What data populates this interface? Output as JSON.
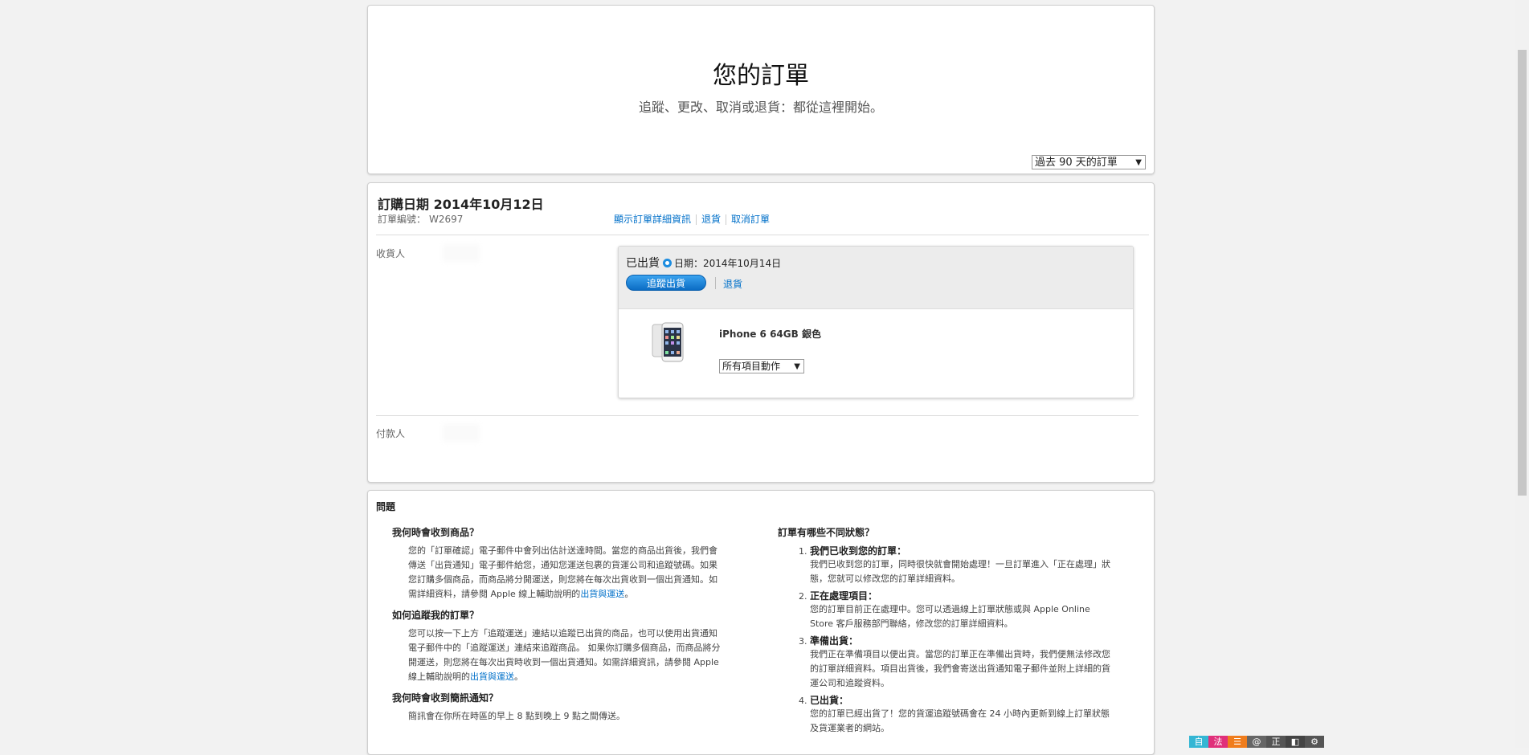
{
  "hero": {
    "title": "您的訂單",
    "subtitle": "追蹤、更改、取消或退貨：都從這裡開始。",
    "range_select": "過去 90 天的訂單"
  },
  "order": {
    "date_label": "訂購日期 2014年10月12日",
    "number_label": "訂單編號：",
    "number_value": "W2697",
    "links": [
      "顯示訂單詳細資訊",
      "退貨",
      "取消訂單"
    ],
    "recipient_label": "收貨人",
    "payer_label": "付款人",
    "shipment": {
      "status": "已出貨",
      "date_label": "日期：2014年10月14日",
      "track_button": "追蹤出貨",
      "return_link": "退貨",
      "product_name": "iPhone 6 64GB 銀色",
      "item_action": "所有項目動作"
    }
  },
  "faq": {
    "title": "問題",
    "left": [
      {
        "q": "我何時會收到商品？",
        "a": "您的「訂單確認」電子郵件中會列出估計送達時間。當您的商品出貨後，我們會傳送「出貨通知」電子郵件給您，通知您運送包裹的貨運公司和追蹤號碼。如果您訂購多個商品，而商品將分開運送，則您將在每次出貨收到一個出貨通知。如需詳細資料，請參閱 Apple 線上輔助說明的",
        "link": "出貨與運送",
        "end": "。"
      },
      {
        "q": "如何追蹤我的訂單？",
        "a": "您可以按一下上方「追蹤運送」連結以追蹤已出貨的商品，也可以使用出貨通知電子郵件中的「追蹤運送」連結來追蹤商品。 如果你訂購多個商品，而商品將分開運送，則您將在每次出貨時收到一個出貨通知。如需詳細資訊，請參閱 Apple 線上輔助說明的",
        "link": "出貨與運送",
        "end": "。"
      },
      {
        "q": "我何時會收到簡訊通知？",
        "a": "簡訊會在你所在時區的早上 8 點到晚上 9 點之間傳送。",
        "link": "",
        "end": ""
      }
    ],
    "right_title": "訂單有哪些不同狀態？",
    "statuses": [
      {
        "title": "我們已收到您的訂單：",
        "desc": "我們已收到您的訂單，同時很快就會開始處理！一旦訂單進入「正在處理」狀態，您就可以修改您的訂單詳細資料。"
      },
      {
        "title": "正在處理項目：",
        "desc": "您的訂單目前正在處理中。您可以透過線上訂單狀態或與 Apple Online Store 客戶服務部門聯絡，修改您的訂單詳細資料。"
      },
      {
        "title": "準備出貨：",
        "desc": "我們正在準備項目以便出貨。當您的訂單正在準備出貨時，我們便無法修改您的訂單詳細資料。項目出貨後，我們會寄送出貨通知電子郵件並附上詳細的貨運公司和追蹤資料。"
      },
      {
        "title": "已出貨：",
        "desc": "您的訂單已經出貨了！您的貨運追蹤號碼會在 24 小時內更新到線上訂單狀態及貨運業者的網站。"
      }
    ]
  },
  "toolbar": {
    "items": [
      "自",
      "法",
      "☰",
      "@",
      "正",
      "◧",
      "⚙"
    ],
    "colors": [
      "#34b6d4",
      "#e0307a",
      "#f07d1d",
      "#666666",
      "#555555",
      "#444444",
      "#555555"
    ]
  }
}
